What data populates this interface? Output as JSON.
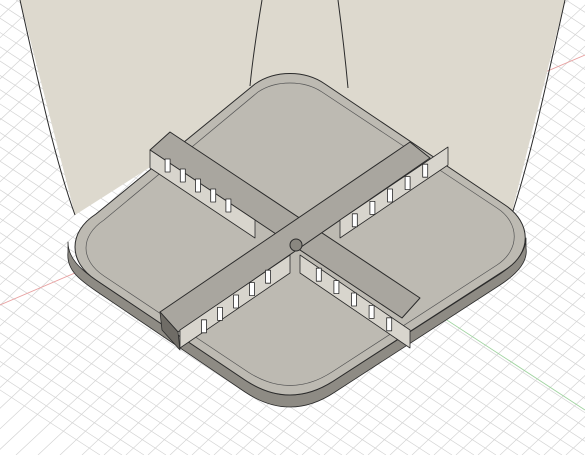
{
  "viewport": {
    "kind": "3d-model-viewport",
    "background_color": "#ffffff",
    "grid_color": "#d4d4d4",
    "axis_x_color": "#e8a0a0",
    "axis_y_color": "#9fd39f"
  },
  "model": {
    "shape": "rounded square body with a cross-shaped divider and slotted walls",
    "body_color": "#ddd9ce",
    "top_face_color": "#bdbab2",
    "edge_color": "#2b2b2b",
    "slot_count_per_arm": 5
  },
  "icons": {
    "center_hole": "center-hole-icon"
  }
}
